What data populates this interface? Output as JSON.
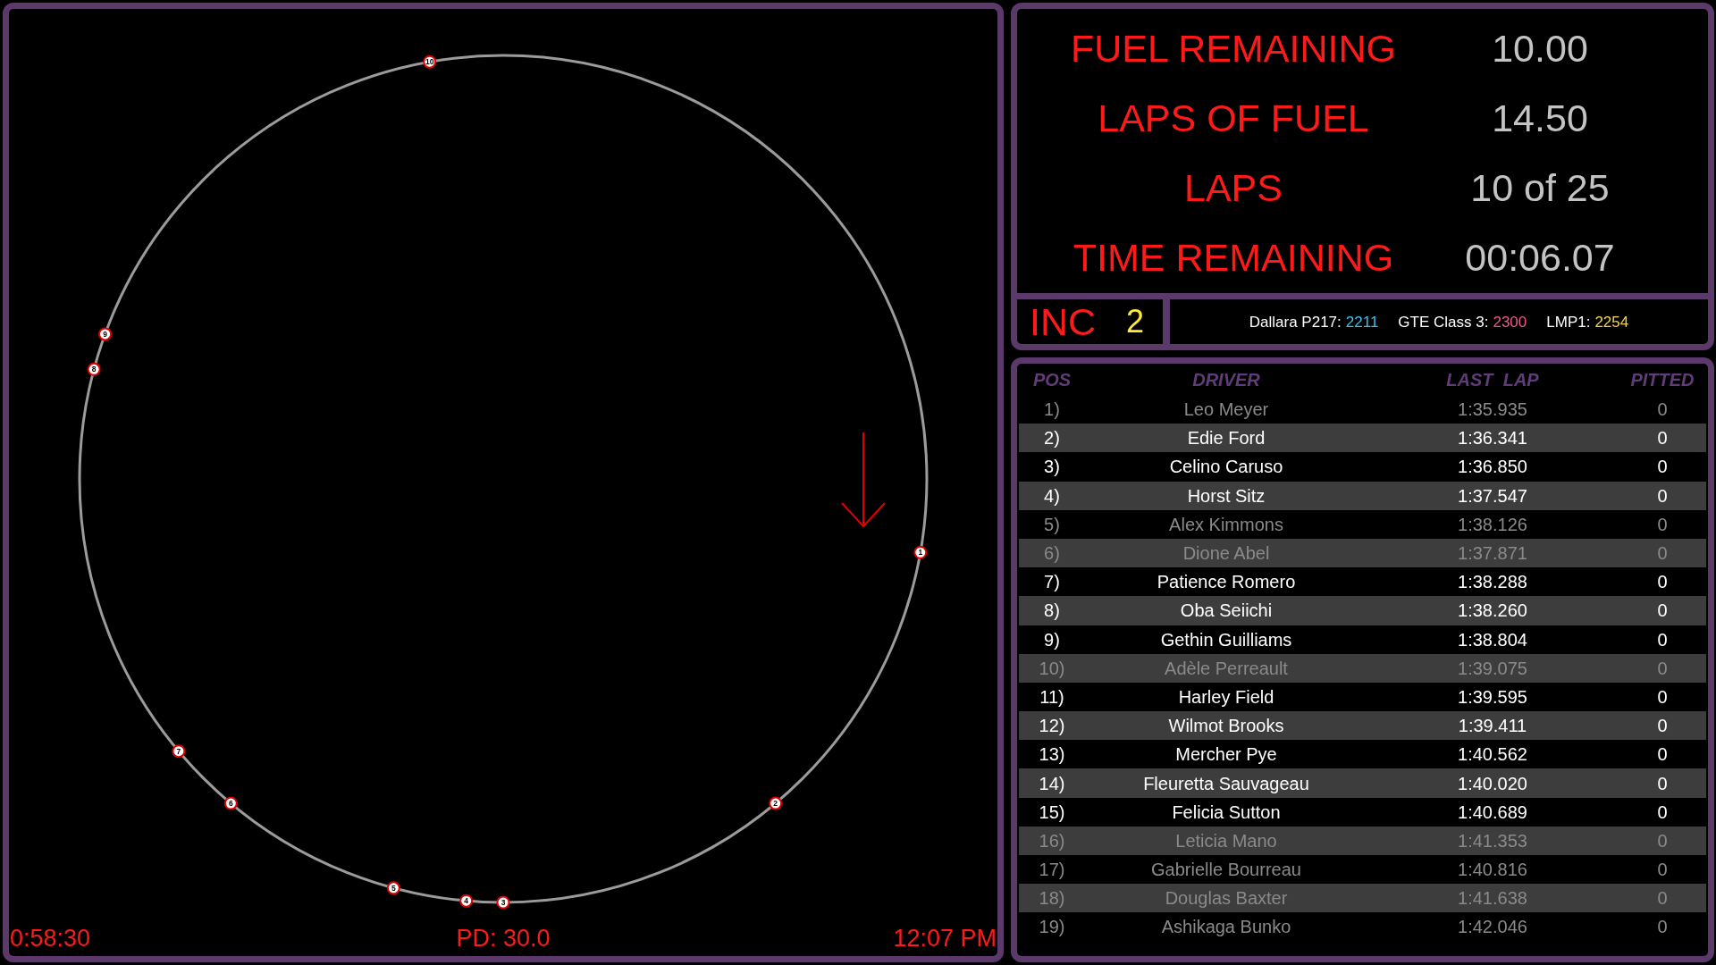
{
  "track_map": {
    "cars": [
      {
        "number": "1"
      },
      {
        "number": "2"
      },
      {
        "number": "3"
      },
      {
        "number": "4"
      },
      {
        "number": "5"
      },
      {
        "number": "6"
      },
      {
        "number": "7"
      },
      {
        "number": "8"
      },
      {
        "number": "9"
      },
      {
        "number": "10"
      }
    ],
    "footer": {
      "timer": "0:58:30",
      "pit_delta": "PD: 30.0",
      "clock": "12:07 PM"
    }
  },
  "stats": [
    {
      "label": "FUEL REMAINING",
      "value": "10.00"
    },
    {
      "label": "LAPS OF FUEL",
      "value": "14.50"
    },
    {
      "label": "LAPS",
      "value": "10 of 25"
    },
    {
      "label": "TIME REMAINING",
      "value": "00:06.07"
    }
  ],
  "incidents": {
    "label": "INC",
    "count": "2"
  },
  "class_times": [
    {
      "name": "Dallara P217:",
      "value": "2211",
      "color": "#3cc0f0"
    },
    {
      "name": "GTE Class 3:",
      "value": "2300",
      "color": "#f0588a"
    },
    {
      "name": "LMP1:",
      "value": "2254",
      "color": "#f6d24a"
    }
  ],
  "standings": {
    "columns": [
      "POS",
      "DRIVER",
      "LAST  LAP",
      "PITTED"
    ],
    "rows": [
      {
        "pos": "1)",
        "driver": "Leo Meyer",
        "last_lap": "1:35.935",
        "pitted": "0",
        "disabled": true
      },
      {
        "pos": "2)",
        "driver": "Edie Ford",
        "last_lap": "1:36.341",
        "pitted": "0",
        "disabled": false
      },
      {
        "pos": "3)",
        "driver": "Celino Caruso",
        "last_lap": "1:36.850",
        "pitted": "0",
        "disabled": false
      },
      {
        "pos": "4)",
        "driver": "Horst Sitz",
        "last_lap": "1:37.547",
        "pitted": "0",
        "disabled": false
      },
      {
        "pos": "5)",
        "driver": "Alex Kimmons",
        "last_lap": "1:38.126",
        "pitted": "0",
        "disabled": true
      },
      {
        "pos": "6)",
        "driver": "Dione Abel",
        "last_lap": "1:37.871",
        "pitted": "0",
        "disabled": true
      },
      {
        "pos": "7)",
        "driver": "Patience Romero",
        "last_lap": "1:38.288",
        "pitted": "0",
        "disabled": false
      },
      {
        "pos": "8)",
        "driver": "Oba Seiichi",
        "last_lap": "1:38.260",
        "pitted": "0",
        "disabled": false
      },
      {
        "pos": "9)",
        "driver": "Gethin Guilliams",
        "last_lap": "1:38.804",
        "pitted": "0",
        "disabled": false
      },
      {
        "pos": "10)",
        "driver": "Adèle Perreault",
        "last_lap": "1:39.075",
        "pitted": "0",
        "disabled": true
      },
      {
        "pos": "11)",
        "driver": "Harley Field",
        "last_lap": "1:39.595",
        "pitted": "0",
        "disabled": false
      },
      {
        "pos": "12)",
        "driver": "Wilmot Brooks",
        "last_lap": "1:39.411",
        "pitted": "0",
        "disabled": false
      },
      {
        "pos": "13)",
        "driver": "Mercher Pye",
        "last_lap": "1:40.562",
        "pitted": "0",
        "disabled": false
      },
      {
        "pos": "14)",
        "driver": "Fleuretta Sauvageau",
        "last_lap": "1:40.020",
        "pitted": "0",
        "disabled": false
      },
      {
        "pos": "15)",
        "driver": "Felicia Sutton",
        "last_lap": "1:40.689",
        "pitted": "0",
        "disabled": false
      },
      {
        "pos": "16)",
        "driver": "Leticia Mano",
        "last_lap": "1:41.353",
        "pitted": "0",
        "disabled": true
      },
      {
        "pos": "17)",
        "driver": "Gabrielle Bourreau",
        "last_lap": "1:40.816",
        "pitted": "0",
        "disabled": true
      },
      {
        "pos": "18)",
        "driver": "Douglas Baxter",
        "last_lap": "1:41.638",
        "pitted": "0",
        "disabled": true
      },
      {
        "pos": "19)",
        "driver": "Ashikaga Bunko",
        "last_lap": "1:42.046",
        "pitted": "0",
        "disabled": true
      }
    ]
  }
}
